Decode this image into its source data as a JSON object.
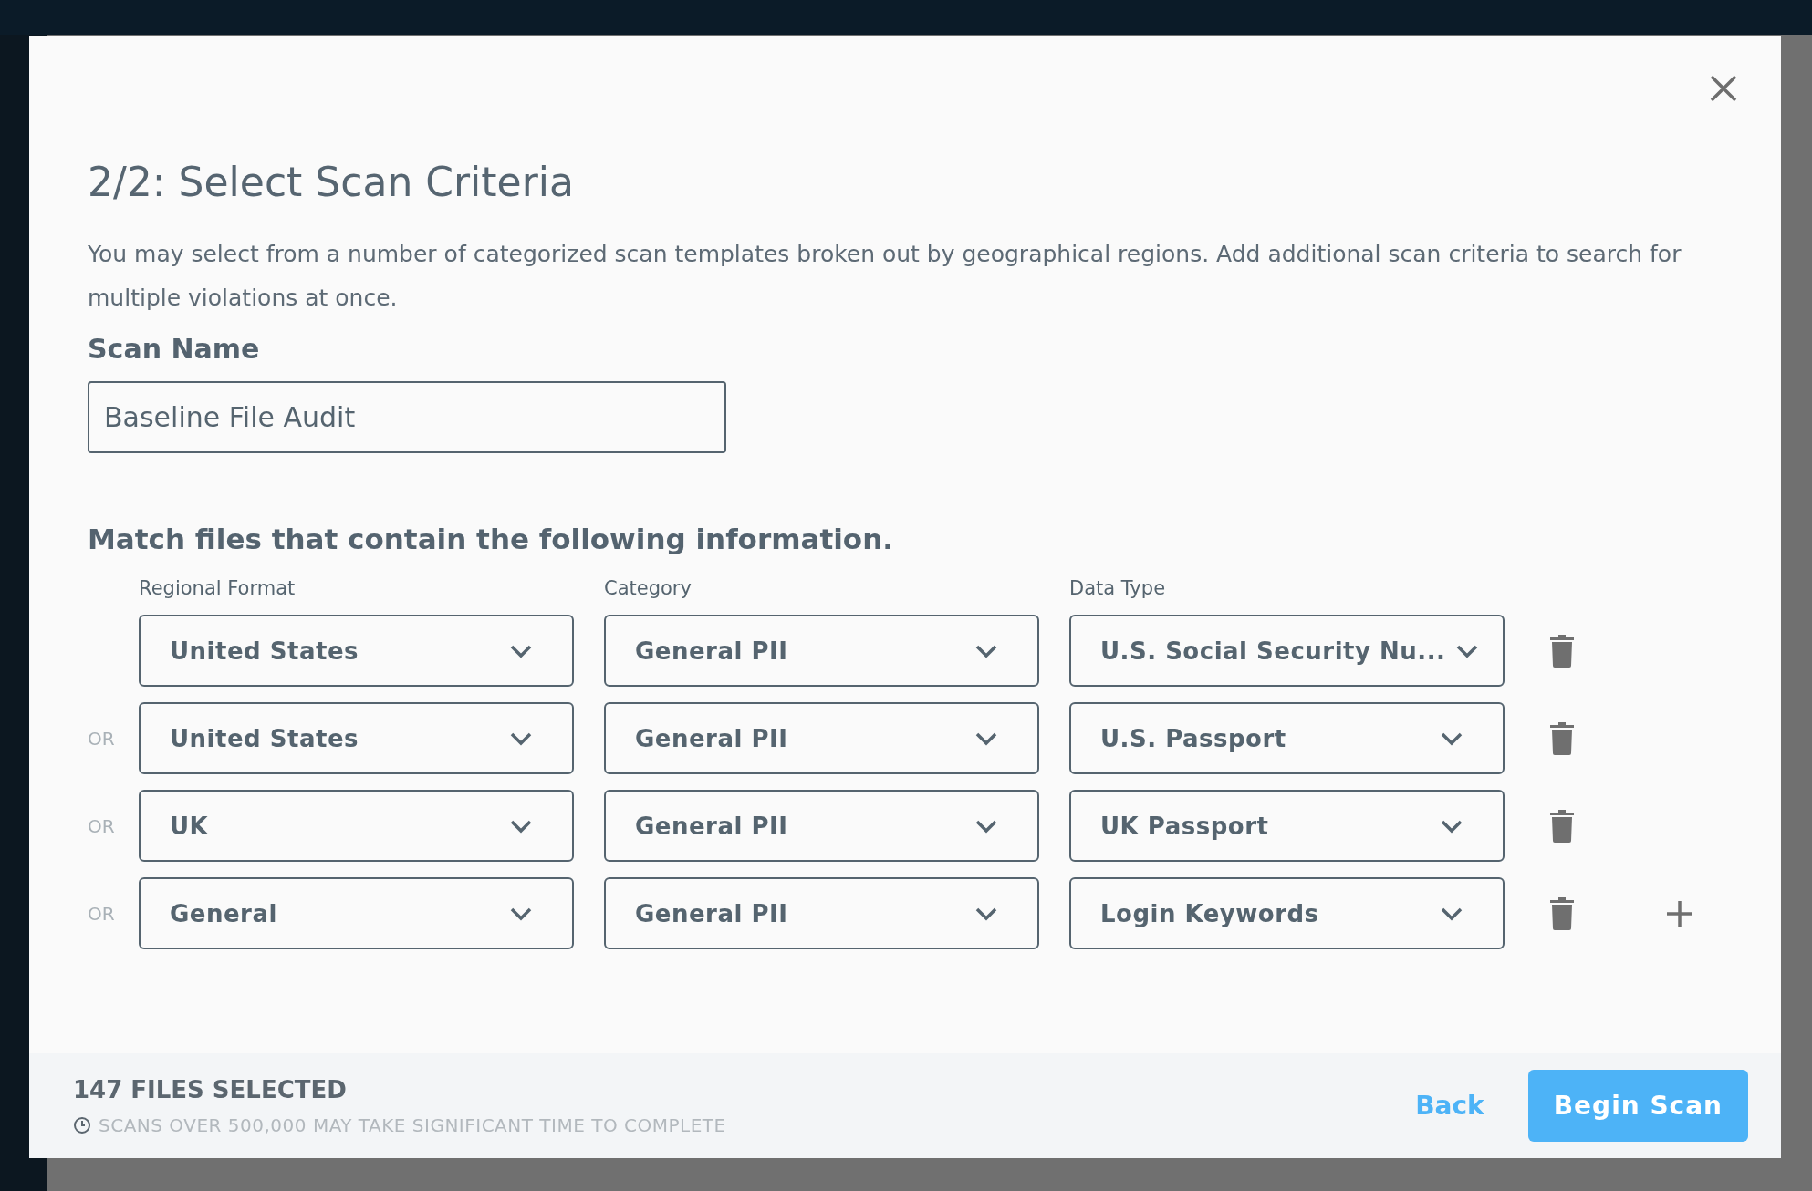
{
  "dialog": {
    "title": "2/2: Select Scan Criteria",
    "description": "You may select from a number of categorized scan templates broken out by geographical regions. Add additional scan criteria to search for multiple violations at once.",
    "scan_name": {
      "label": "Scan Name",
      "value": "Baseline File Audit"
    },
    "criteria": {
      "heading": "Match files that contain the following information.",
      "columns": [
        "Regional Format",
        "Category",
        "Data Type"
      ],
      "rows": [
        {
          "connector": "",
          "region": "United States",
          "category": "General PII",
          "data_type": "U.S. Social Security Nu...",
          "can_add": false
        },
        {
          "connector": "OR",
          "region": "United States",
          "category": "General PII",
          "data_type": "U.S. Passport",
          "can_add": false
        },
        {
          "connector": "OR",
          "region": "UK",
          "category": "General PII",
          "data_type": "UK Passport",
          "can_add": false
        },
        {
          "connector": "OR",
          "region": "General",
          "category": "General PII",
          "data_type": "Login Keywords",
          "can_add": true
        }
      ]
    }
  },
  "footer": {
    "count": "147 FILES SELECTED",
    "note": "SCANS OVER 500,000 MAY TAKE SIGNIFICANT TIME TO COMPLETE",
    "buttons": [
      {
        "kind": "link",
        "label": "Back"
      },
      {
        "kind": "primary",
        "label": "Begin Scan"
      }
    ]
  }
}
